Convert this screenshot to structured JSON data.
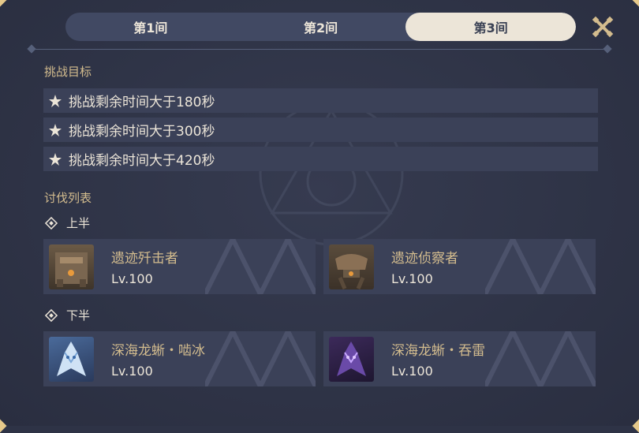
{
  "tabs": [
    {
      "label": "第1间",
      "active": false
    },
    {
      "label": "第2间",
      "active": false
    },
    {
      "label": "第3间",
      "active": true
    }
  ],
  "challenge": {
    "title": "挑战目标",
    "goals": [
      "挑战剩余时间大于180秒",
      "挑战剩余时间大于300秒",
      "挑战剩余时间大于420秒"
    ]
  },
  "enemies": {
    "title": "讨伐列表",
    "first_half": {
      "label": "上半",
      "list": [
        {
          "name": "遗迹歼击者",
          "level": "Lv.100",
          "icon": "ruin-destroyer-portrait"
        },
        {
          "name": "遗迹侦察者",
          "level": "Lv.100",
          "icon": "ruin-scout-portrait"
        }
      ]
    },
    "second_half": {
      "label": "下半",
      "list": [
        {
          "name": "深海龙蜥・啮冰",
          "level": "Lv.100",
          "icon": "frost-abyssal-drake-portrait"
        },
        {
          "name": "深海龙蜥・吞雷",
          "level": "Lv.100",
          "icon": "electro-abyssal-drake-portrait"
        }
      ]
    }
  },
  "colors": {
    "background": "#2e3346",
    "accent_gold": "#d3bc8e",
    "text_light": "#ece5d8",
    "row_bg": "#3b4158"
  }
}
